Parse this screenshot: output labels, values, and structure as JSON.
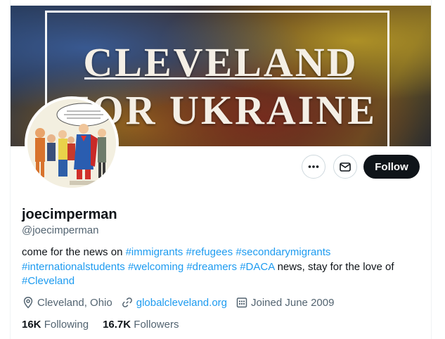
{
  "banner": {
    "line1": "CLEVELAND",
    "line2": "FOR UKRAINE"
  },
  "actions": {
    "more_icon": "more-horizontal-icon",
    "message_icon": "envelope-icon",
    "follow_label": "Follow"
  },
  "profile": {
    "name": "joecimperman",
    "handle": "@joecimperman",
    "bio": {
      "prefix": "come for the news on ",
      "hashtags_line1": [
        "#immigrants",
        "#refugees",
        "#secondarymigrants"
      ],
      "hashtags_line2": [
        "#internationalstudents",
        "#welcoming",
        "#dreamers",
        "#DACA"
      ],
      "middle": " news, stay for the love of",
      "last_hashtag": "#Cleveland"
    },
    "location": "Cleveland, Ohio",
    "website": "globalcleveland.org",
    "joined": "Joined June 2009",
    "following_count": "16K",
    "following_label": "Following",
    "followers_count": "16.7K",
    "followers_label": "Followers"
  },
  "colors": {
    "link": "#1d9bf0",
    "text": "#0f1419",
    "secondary": "#536471",
    "follow_bg": "#0f1419"
  }
}
